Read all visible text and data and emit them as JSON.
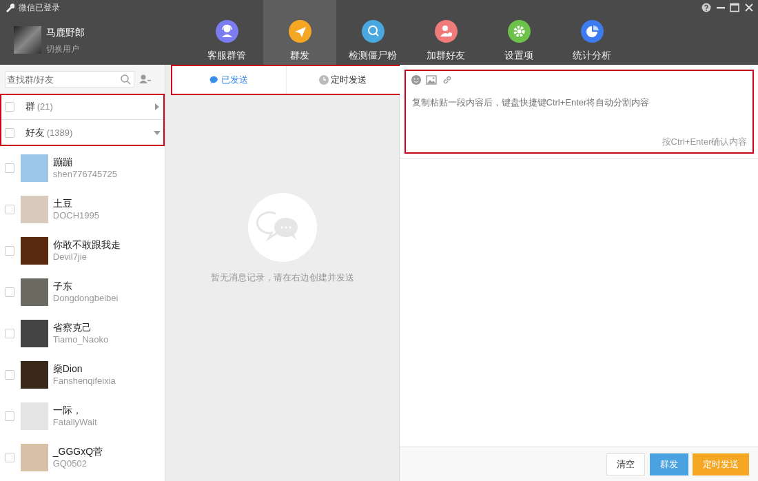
{
  "window": {
    "title": "微信已登录"
  },
  "user": {
    "name": "马鹿野郎",
    "switch_label": "切换用户"
  },
  "nav": [
    {
      "label": "客服群管",
      "selected": false,
      "color": "#7b7cf0"
    },
    {
      "label": "群发",
      "selected": true,
      "color": "#f5a623"
    },
    {
      "label": "检测僵尸粉",
      "selected": false,
      "color": "#4aa8e0"
    },
    {
      "label": "加群好友",
      "selected": false,
      "color": "#ef7b7b"
    },
    {
      "label": "设置项",
      "selected": false,
      "color": "#6cc24a"
    },
    {
      "label": "统计分析",
      "selected": false,
      "color": "#3d7cf0"
    }
  ],
  "search": {
    "placeholder": "查找群/好友"
  },
  "contact_groups": {
    "highlighted": true,
    "items": [
      {
        "label": "群",
        "count": "(21)",
        "checked": false,
        "expanded": false
      },
      {
        "label": "好友",
        "count": "(1389)",
        "checked": false,
        "expanded": true
      }
    ]
  },
  "contacts": [
    {
      "name": "蹦蹦",
      "id": "shen776745725",
      "checked": false
    },
    {
      "name": "土豆",
      "id": "DOCH1995",
      "checked": false
    },
    {
      "name": "你敢不敢跟我走",
      "id": "Devil7jie",
      "checked": false
    },
    {
      "name": "子东",
      "id": "Dongdongbeibei",
      "checked": false
    },
    {
      "name": "省察克己",
      "id": "Tiamo_Naoko",
      "checked": false
    },
    {
      "name": "燊Dion",
      "id": "Fanshenqifeixia",
      "checked": false
    },
    {
      "name": "一际，",
      "id": "FatallyWait",
      "checked": false
    },
    {
      "name": "_GGGxQ菅",
      "id": "GQ0502",
      "checked": false
    }
  ],
  "send_tabs": {
    "highlighted": true,
    "items": [
      {
        "label": "已发送",
        "selected": true
      },
      {
        "label": "定时发送",
        "selected": false
      }
    ]
  },
  "empty_state": {
    "message": "暂无消息记录，请在右边创建并发送"
  },
  "composer": {
    "highlighted": true,
    "placeholder": "复制粘贴一段内容后，键盘快捷键Ctrl+Enter将自动分割内容",
    "hint": "按Ctrl+Enter确认内容"
  },
  "buttons": [
    {
      "label": "清空",
      "kind": "plain"
    },
    {
      "label": "群发",
      "kind": "primary"
    },
    {
      "label": "定时发送",
      "kind": "warning"
    }
  ]
}
